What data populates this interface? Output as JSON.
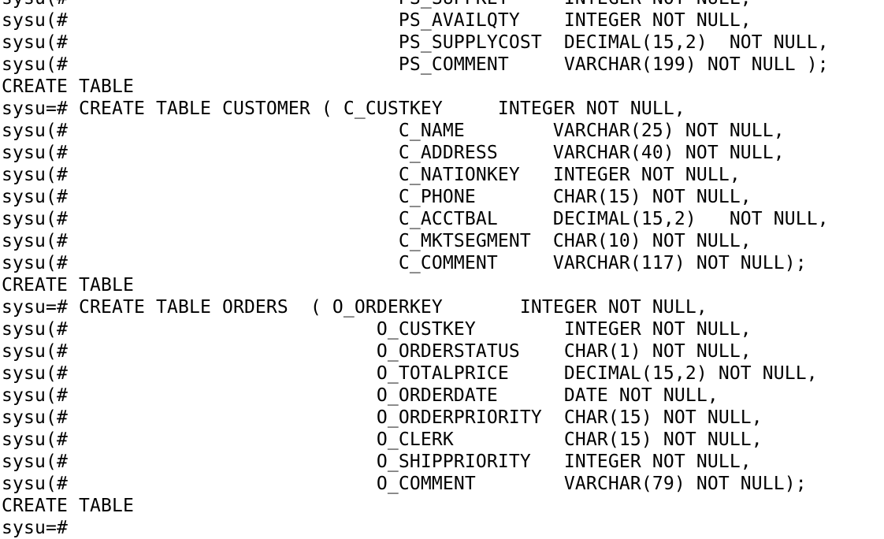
{
  "terminal": {
    "colors": {
      "background": "#ffffff",
      "text": "#000000"
    },
    "lines": [
      "sysu(#                              PS_SUPPKEY     INTEGER NOT NULL,",
      "sysu(#                              PS_AVAILQTY    INTEGER NOT NULL,",
      "sysu(#                              PS_SUPPLYCOST  DECIMAL(15,2)  NOT NULL,",
      "sysu(#                              PS_COMMENT     VARCHAR(199) NOT NULL );",
      "CREATE TABLE",
      "sysu=# CREATE TABLE CUSTOMER ( C_CUSTKEY     INTEGER NOT NULL,",
      "sysu(#                              C_NAME        VARCHAR(25) NOT NULL,",
      "sysu(#                              C_ADDRESS     VARCHAR(40) NOT NULL,",
      "sysu(#                              C_NATIONKEY   INTEGER NOT NULL,",
      "sysu(#                              C_PHONE       CHAR(15) NOT NULL,",
      "sysu(#                              C_ACCTBAL     DECIMAL(15,2)   NOT NULL,",
      "sysu(#                              C_MKTSEGMENT  CHAR(10) NOT NULL,",
      "sysu(#                              C_COMMENT     VARCHAR(117) NOT NULL);",
      "CREATE TABLE",
      "sysu=# CREATE TABLE ORDERS  ( O_ORDERKEY       INTEGER NOT NULL,",
      "sysu(#                            O_CUSTKEY        INTEGER NOT NULL,",
      "sysu(#                            O_ORDERSTATUS    CHAR(1) NOT NULL,",
      "sysu(#                            O_TOTALPRICE     DECIMAL(15,2) NOT NULL,",
      "sysu(#                            O_ORDERDATE      DATE NOT NULL,",
      "sysu(#                            O_ORDERPRIORITY  CHAR(15) NOT NULL,",
      "sysu(#                            O_CLERK          CHAR(15) NOT NULL,",
      "sysu(#                            O_SHIPPRIORITY   INTEGER NOT NULL,",
      "sysu(#                            O_COMMENT        VARCHAR(79) NOT NULL);",
      "CREATE TABLE",
      "sysu=# "
    ]
  }
}
